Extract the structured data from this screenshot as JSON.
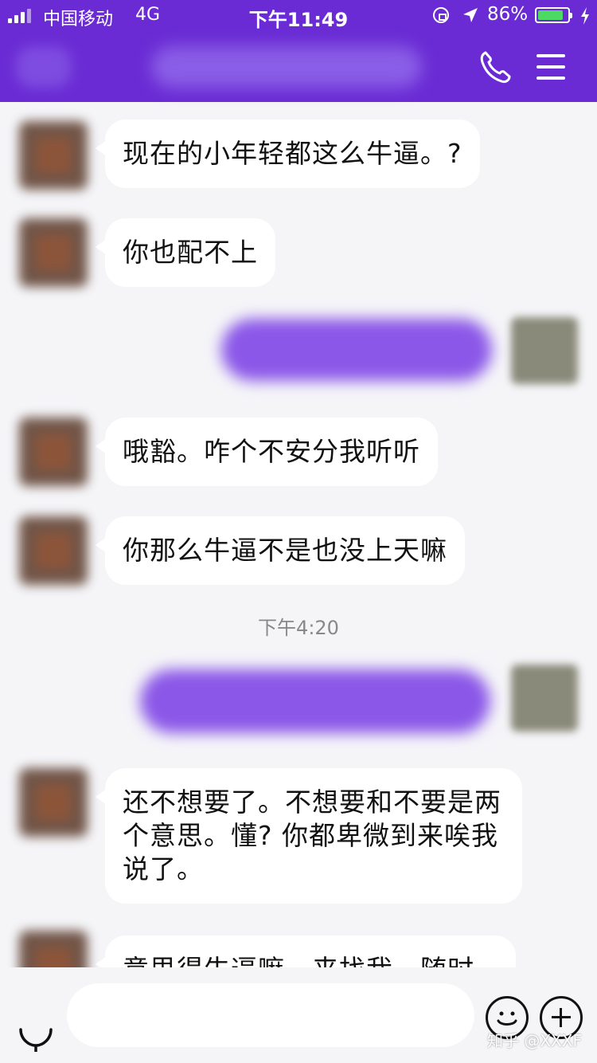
{
  "status_bar": {
    "carrier": "中国移动",
    "network": "4G",
    "time": "下午11:49",
    "battery_percent": "86%",
    "battery_level": 0.86
  },
  "nav": {
    "phone_icon": "phone-icon",
    "menu_icon": "menu-icon"
  },
  "messages": {
    "m1": "现在的小年轻都这么牛逼。?",
    "m2": "你也配不上",
    "m3": "哦豁。咋个不安分我听听",
    "m4": "你那么牛逼不是也没上天嘛",
    "timestamp": "下午4:20",
    "m5": "还不想要了。不想要和不要是两个意思。懂? 你都卑微到来唉我说了。",
    "m6": "意思得牛逼嘛，来找我，随时"
  },
  "input_bar": {
    "placeholder": "",
    "voice_icon": "voice-icon",
    "emoji_icon": "emoji-icon",
    "plus_icon": "plus-icon"
  },
  "watermark": "知乎 @XXXF",
  "colors": {
    "brand": "#6a2bd4",
    "outgoing_bubble": "#8b57e8",
    "background": "#f5f5f8"
  }
}
